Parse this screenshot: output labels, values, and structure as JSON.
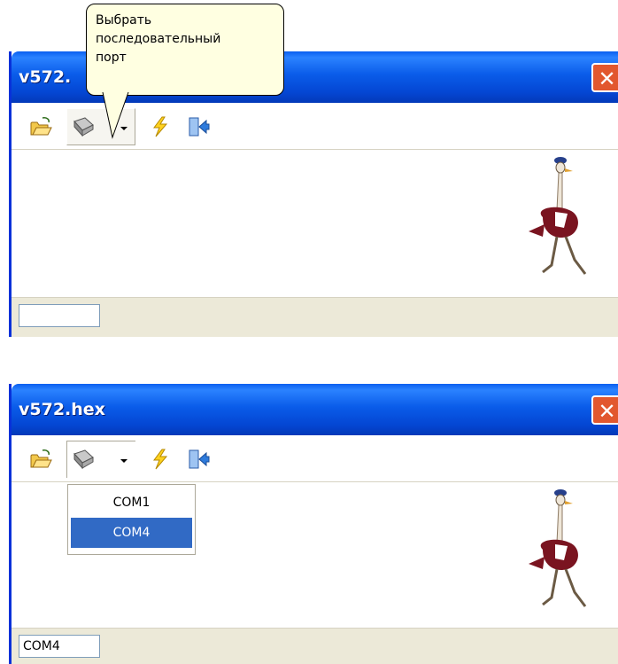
{
  "tooltip": {
    "text_lines": [
      "Выбрать",
      "последовательный",
      "порт"
    ]
  },
  "window1": {
    "title": "v572.",
    "close_glyph": "✕",
    "status": ""
  },
  "window2": {
    "title": "v572.hex",
    "close_glyph": "✕",
    "status": "COM4",
    "dropdown": {
      "options": [
        "COM1",
        "COM4"
      ],
      "selected": "COM4"
    }
  },
  "toolbar_icons": [
    "open-folder-icon",
    "serial-port-icon",
    "dropdown-arrow-icon",
    "lightning-icon",
    "exit-door-icon"
  ],
  "colors": {
    "titlebar": "#0a5ce9",
    "close": "#e2572e",
    "tooltip_bg": "#ffffe1",
    "selection": "#316ac5"
  }
}
